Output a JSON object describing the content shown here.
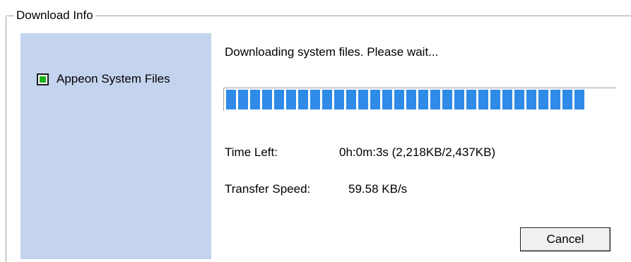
{
  "group": {
    "title": "Download Info"
  },
  "items": [
    {
      "label": "Appeon System Files",
      "status_color": "#19b219"
    }
  ],
  "status": {
    "message": "Downloading system files. Please wait..."
  },
  "progress": {
    "filled_segments": 30,
    "segment_color": "#2f8ae8"
  },
  "details": {
    "time_left_label": "Time Left:",
    "time_left_value": "0h:0m:3s (2,218KB/2,437KB)",
    "speed_label": "Transfer Speed:",
    "speed_value": "59.58 KB/s"
  },
  "buttons": {
    "cancel_label": "Cancel"
  },
  "colors": {
    "side_panel_bg": "#c5d4ee"
  }
}
